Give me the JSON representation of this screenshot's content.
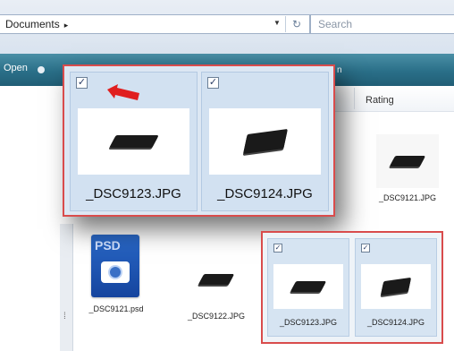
{
  "window": {
    "address_path": "Documents",
    "address_arrow": "▸",
    "search_placeholder": "Search"
  },
  "toolbar": {
    "open_label": "Open",
    "right_fragment": "n"
  },
  "columns": {
    "rating_label": "Rating"
  },
  "popup_large": {
    "items": [
      {
        "filename": "_DSC9123.JPG",
        "checked": true
      },
      {
        "filename": "_DSC9124.JPG",
        "checked": true
      }
    ]
  },
  "background_items": {
    "right_thumb": {
      "filename": "_DSC9121.JPG"
    },
    "psd_file": {
      "badge": "PSD",
      "filename": "_DSC9121.psd"
    },
    "second_thumb": {
      "filename": "_DSC9122.JPG"
    }
  },
  "popup_small": {
    "items": [
      {
        "filename": "_DSC9123.JPG",
        "checked": true
      },
      {
        "filename": "_DSC9124.JPG",
        "checked": true
      }
    ]
  },
  "colors": {
    "highlight_border": "#d94c4c",
    "toolbar": "#2a6f88",
    "selection": "#d2e1f1",
    "arrow": "#e01f1f"
  },
  "icons": {
    "checkbox": "✓",
    "pointer": "red-arrow-icon",
    "refresh": "↻"
  }
}
